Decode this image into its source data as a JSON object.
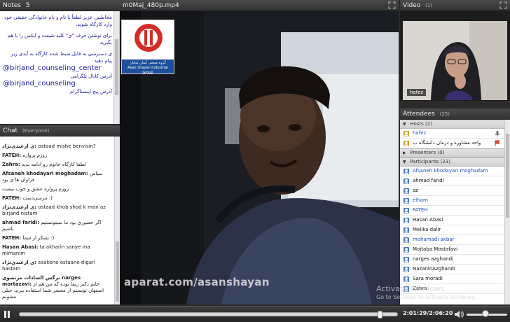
{
  "notes": {
    "title": "Notes",
    "count": "5",
    "lines": [
      "مخاطبین عزیز لطفاً با نام و نام خانوادگی حقیقی خود وارد کارگاه شوید.",
      "برای نوشتن حرف \"ی\" کلید شیفت و ایکس را با هم بگیرید",
      "ی دسترسی به فایل ضبط شده کارگاه به آیدی زیر پیام دهید",
      "@birjand_counseling_center",
      "آدرس کانال تلگرامی",
      "@birjand_counseling",
      "آدرس پیج اینستاگرام"
    ]
  },
  "chat": {
    "title": "Chat",
    "scope": "(Everyone)",
    "messages": [
      {
        "name": "ی ارغندی‌نژاد:",
        "text": "ostaad  mishe  benvisin?"
      },
      {
        "name": "FATEH:",
        "text": "روزم پرواره"
      },
      {
        "name": "Zahra:",
        "text": "لطفا کارگاه خانوم رو ادامه بدید"
      },
      {
        "name": "Afsaneh khodayari moghadam:",
        "text": "سپاس فراوان ها ی بود"
      },
      {
        "name": "",
        "text": "روزم پرواره عشق و جوب نیست"
      },
      {
        "name": "FATEH:",
        "text": "مرسی‌دست :)"
      },
      {
        "name": "ی ارغندی‌نژاد:",
        "text": "ostaad  khob  shod  k  man az birjand  nistam"
      },
      {
        "name": "ahmad faridi:",
        "text": "اگر حضوری بود ما نمیتونستیم باشیم"
      },
      {
        "name": "FATEH:",
        "text": "تشکر از شما :)"
      },
      {
        "name": "Hasan Abasi:",
        "text": "ta akharin sanye ma mimanim"
      },
      {
        "name": "ی ارغندی‌نژاد:",
        "text": "saakene  ostaane  digari  hastam"
      },
      {
        "name": "نرگس السادات مرتضوی  narges mortazavi:",
        "text": "خانم دکتر ریما بوده که من هم از اصفهان تونستم از محضر شما استفاده ببرم، خیلی ممنونم"
      }
    ]
  },
  "share": {
    "title": "m0Maj_480p.mp4",
    "watermark": "aparat.com/asanshayan",
    "logo_line1": "گروه صنعتی آسان شایان",
    "logo_line2": "Asan Shayan Industrial Group"
  },
  "video": {
    "title": "Video",
    "count": "(1)",
    "camera_label": "hafez"
  },
  "attendees": {
    "title": "Attendees",
    "count": "(25)",
    "hosts_label": "Hosts (2)",
    "hosts": [
      {
        "name": "hafez",
        "blue": true
      },
      {
        "name": "واحد مشاوره و درمان دانشگاه ب",
        "blue": false
      }
    ],
    "presenters_label": "Presenters (0)",
    "participants_label": "Participants (23)",
    "participants": [
      {
        "name": "Afsaneh khodayari moghadam",
        "blue": true
      },
      {
        "name": "ahmad faridi",
        "blue": false
      },
      {
        "name": "az",
        "blue": false
      },
      {
        "name": "elham",
        "blue": true
      },
      {
        "name": "FATEH",
        "blue": true
      },
      {
        "name": "Hasan Abasi",
        "blue": false
      },
      {
        "name": "Melika dalir",
        "blue": false
      },
      {
        "name": "mohamadi akbar",
        "blue": true
      },
      {
        "name": "Mojtaba Mostafavi",
        "blue": false
      },
      {
        "name": "narges azghandi",
        "blue": false
      },
      {
        "name": "NazaninAzghandi",
        "blue": false
      },
      {
        "name": "Sara moradi",
        "blue": false
      },
      {
        "name": "Zahra",
        "blue": false
      }
    ]
  },
  "controls": {
    "time": "2:01:29/2:06:20",
    "progress": 0.96,
    "volume": 0.45
  },
  "os_watermark": {
    "line1": "Activate Windows",
    "line2": "Go to Settings to activate Windows."
  }
}
